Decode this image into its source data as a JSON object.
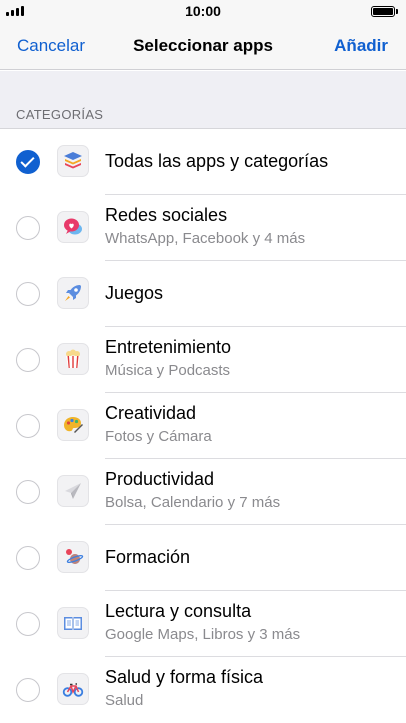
{
  "status_bar": {
    "time": "10:00"
  },
  "nav": {
    "cancel": "Cancelar",
    "title": "Seleccionar apps",
    "add": "Añadir"
  },
  "section_header": "CATEGORÍAS",
  "rows": [
    {
      "title": "Todas las apps y categorías",
      "subtitle": "",
      "checked": true,
      "icon": "stack-icon"
    },
    {
      "title": "Redes sociales",
      "subtitle": "WhatsApp, Facebook y 4 más",
      "checked": false,
      "icon": "chat-heart-icon"
    },
    {
      "title": "Juegos",
      "subtitle": "",
      "checked": false,
      "icon": "rocket-icon"
    },
    {
      "title": "Entretenimiento",
      "subtitle": "Música y Podcasts",
      "checked": false,
      "icon": "popcorn-icon"
    },
    {
      "title": "Creatividad",
      "subtitle": "Fotos y Cámara",
      "checked": false,
      "icon": "palette-icon"
    },
    {
      "title": "Productividad",
      "subtitle": "Bolsa, Calendario y 7 más",
      "checked": false,
      "icon": "paper-plane-icon"
    },
    {
      "title": "Formación",
      "subtitle": "",
      "checked": false,
      "icon": "planet-icon"
    },
    {
      "title": "Lectura y consulta",
      "subtitle": "Google Maps, Libros y 3 más",
      "checked": false,
      "icon": "book-icon"
    },
    {
      "title": "Salud y forma física",
      "subtitle": "Salud",
      "checked": false,
      "icon": "bicycle-icon"
    }
  ],
  "colors": {
    "accent": "#1060d0",
    "group_background": "#efeff4",
    "secondary_text": "#8a8a8e"
  }
}
